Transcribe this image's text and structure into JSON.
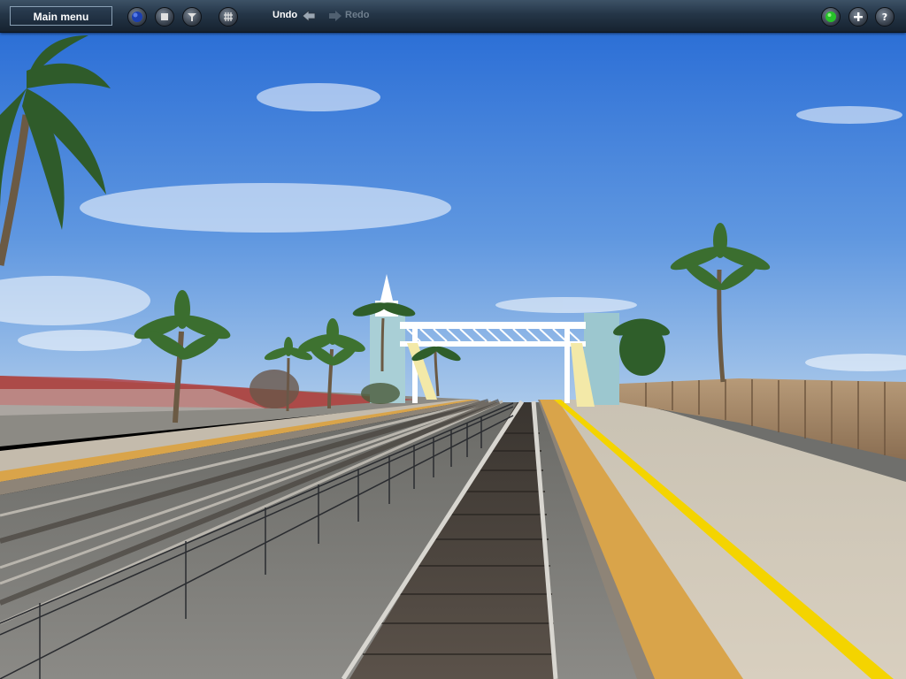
{
  "toolbar": {
    "main_menu_label": "Main menu",
    "undo_label": "Undo",
    "redo_label": "Redo",
    "left_tools": [
      "globe-icon",
      "stop-icon",
      "filter-icon",
      "grid-icon"
    ],
    "right_tools": [
      "status-light-icon",
      "plus-icon",
      "help-icon"
    ]
  },
  "colors": {
    "sky_top": "#2c6fd6",
    "sky_bottom": "#a9c8ea",
    "platform_yellow_line": "#f4d400",
    "tactile_strip": "#d9a44a",
    "status_light": "#27c22a"
  }
}
